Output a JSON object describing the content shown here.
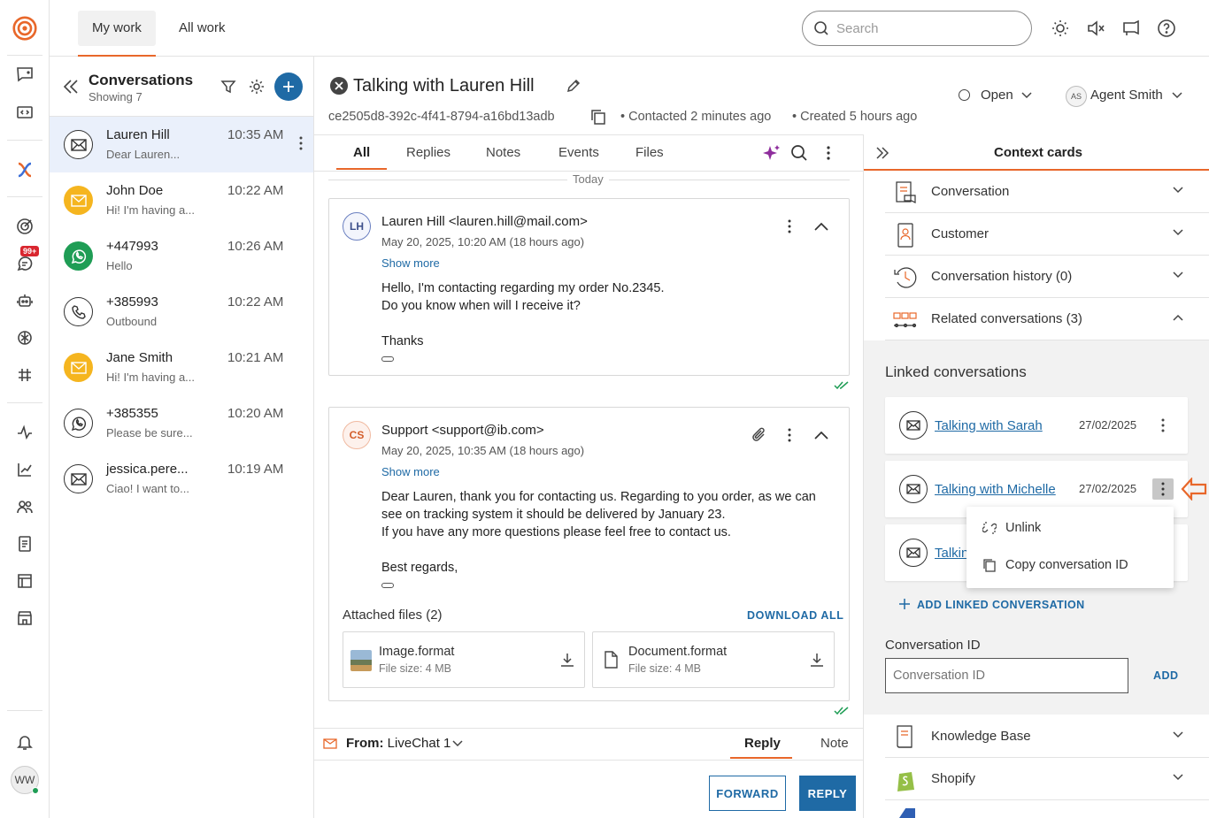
{
  "topbar": {
    "tabs": [
      "My work",
      "All work"
    ],
    "search_placeholder": "Search"
  },
  "rail": {
    "badge": "99+",
    "avatar_initials": "WW"
  },
  "conversations": {
    "title": "Conversations",
    "showing": "Showing 7",
    "items": [
      {
        "name": "Lauren Hill",
        "preview": "Dear Lauren...",
        "time": "10:35 AM",
        "channel": "email"
      },
      {
        "name": "John Doe",
        "preview": "Hi! I'm having a...",
        "time": "10:22 AM",
        "channel": "email"
      },
      {
        "name": "+447993",
        "preview": "Hello",
        "time": "10:26 AM",
        "channel": "whatsapp"
      },
      {
        "name": "+385993",
        "preview": "Outbound",
        "time": "10:22 AM",
        "channel": "phone"
      },
      {
        "name": "Jane Smith",
        "preview": "Hi! I'm having a...",
        "time": "10:21 AM",
        "channel": "email"
      },
      {
        "name": "+385355",
        "preview": "Please be sure...",
        "time": "10:20 AM",
        "channel": "whatsapp"
      },
      {
        "name": "jessica.pere...",
        "preview": "Ciao! I want to...",
        "time": "10:19 AM",
        "channel": "email"
      }
    ]
  },
  "conversation": {
    "title": "Talking with Lauren Hill",
    "id": "ce2505d8-392c-4f41-8794-a16bd13adb",
    "contacted": "Contacted 2 minutes ago",
    "created": "Created 5 hours ago",
    "status": "Open",
    "agent_initials": "AS",
    "agent": "Agent Smith",
    "tabs": [
      "All",
      "Replies",
      "Notes",
      "Events",
      "Files"
    ],
    "day_label": "Today"
  },
  "messages": [
    {
      "initials": "LH",
      "from": "Lauren Hill <lauren.hill@mail.com>",
      "date": "May 20, 2025, 10:20 AM (18 hours ago)",
      "show_more": "Show more",
      "body": [
        "Hello, I'm contacting regarding my order No.2345.",
        "Do you know when will I receive it?",
        "",
        "Thanks"
      ]
    },
    {
      "initials": "CS",
      "from": "Support <support@ib.com>",
      "date": "May 20, 2025, 10:35 AM (18 hours ago)",
      "show_more": "Show more",
      "body": [
        "Dear Lauren, thank you for contacting us.  Regarding to you order, as we can",
        "see on tracking system it should be delivered by January 23.",
        "If you have any more questions please feel free to contact us.",
        "",
        "Best regards,"
      ],
      "attachments_title": "Attached files (2)",
      "download_all": "DOWNLOAD ALL",
      "files": [
        {
          "name": "Image.format",
          "size": "File size: 4 MB"
        },
        {
          "name": "Document.format",
          "size": "File size: 4 MB"
        }
      ]
    }
  ],
  "composer": {
    "from_label": "From:",
    "from_value": "LiveChat 1",
    "tab_reply": "Reply",
    "tab_note": "Note",
    "forward": "FORWARD",
    "reply": "REPLY"
  },
  "context": {
    "title": "Context cards",
    "cards": [
      "Conversation",
      "Customer",
      "Conversation history (0)",
      "Related conversations (3)"
    ],
    "linked_title": "Linked conversations",
    "linked": [
      {
        "name": "Talking with Sarah",
        "date": "27/02/2025"
      },
      {
        "name": "Talking with Michelle",
        "date": "27/02/2025"
      },
      {
        "name": "Talking with",
        "date": ""
      }
    ],
    "menu": {
      "unlink": "Unlink",
      "copy": "Copy conversation ID"
    },
    "add_linked": "ADD LINKED CONVERSATION",
    "conv_id_label": "Conversation ID",
    "conv_id_placeholder": "Conversation ID",
    "add": "ADD",
    "more_cards": [
      "Knowledge Base",
      "Shopify"
    ]
  },
  "colors": {
    "accent": "#e8672a",
    "primary": "#1f6aa5",
    "selected_bg": "#eaf0fb",
    "email_yellow": "#f5b51f",
    "whatsapp_green": "#1f9d55"
  }
}
